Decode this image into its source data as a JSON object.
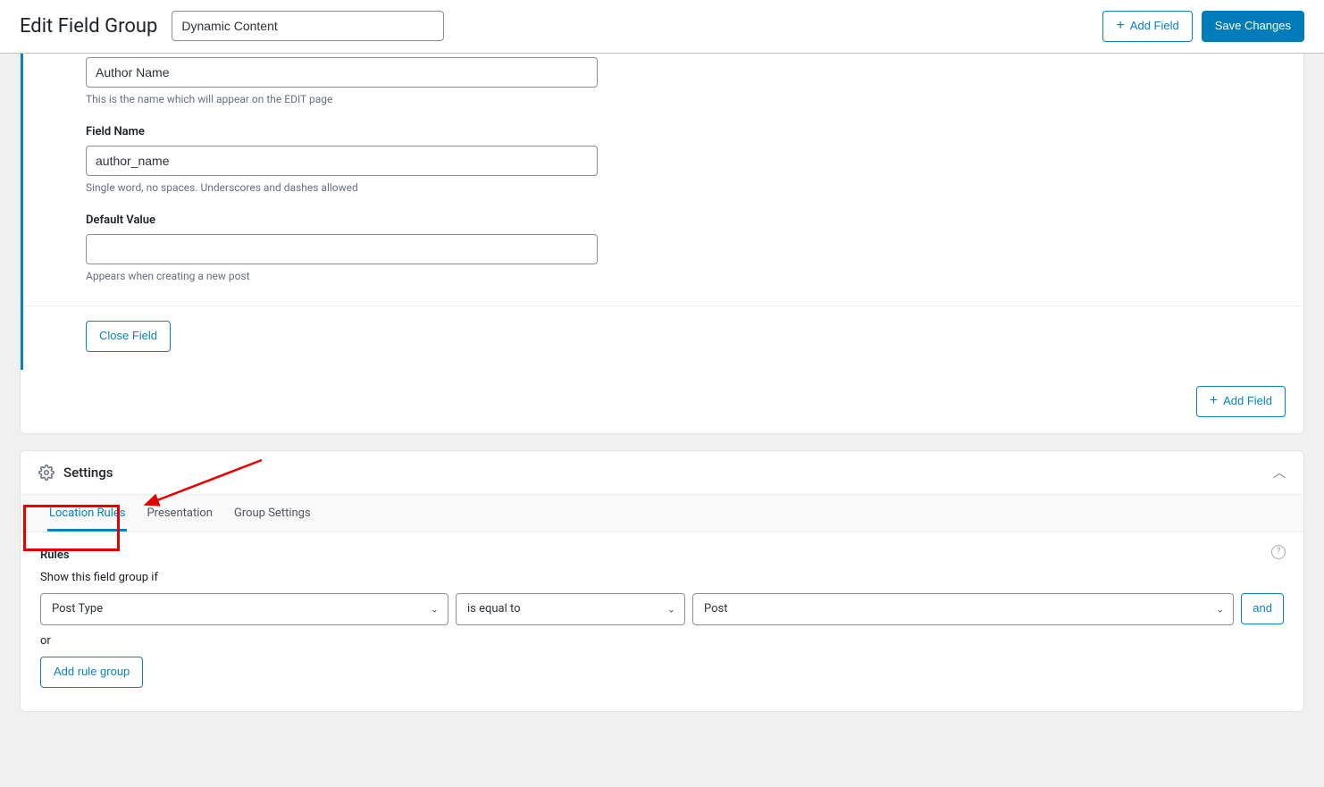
{
  "header": {
    "title": "Edit Field Group",
    "group_name": "Dynamic Content",
    "add_field_label": "Add Field",
    "save_label": "Save Changes"
  },
  "field": {
    "label_value": "Author Name",
    "label_hint": "This is the name which will appear on the EDIT page",
    "name_label": "Field Name",
    "name_value": "author_name",
    "name_hint": "Single word, no spaces. Underscores and dashes allowed",
    "default_label": "Default Value",
    "default_value": "",
    "default_hint": "Appears when creating a new post",
    "close_label": "Close Field"
  },
  "footer": {
    "add_field_label": "Add Field"
  },
  "settings": {
    "title": "Settings",
    "tabs": [
      "Location Rules",
      "Presentation",
      "Group Settings"
    ]
  },
  "rules": {
    "heading": "Rules",
    "subheading": "Show this field group if",
    "selects": {
      "param": "Post Type",
      "operator": "is equal to",
      "value": "Post"
    },
    "and_label": "and",
    "or_label": "or",
    "add_group_label": "Add rule group"
  }
}
